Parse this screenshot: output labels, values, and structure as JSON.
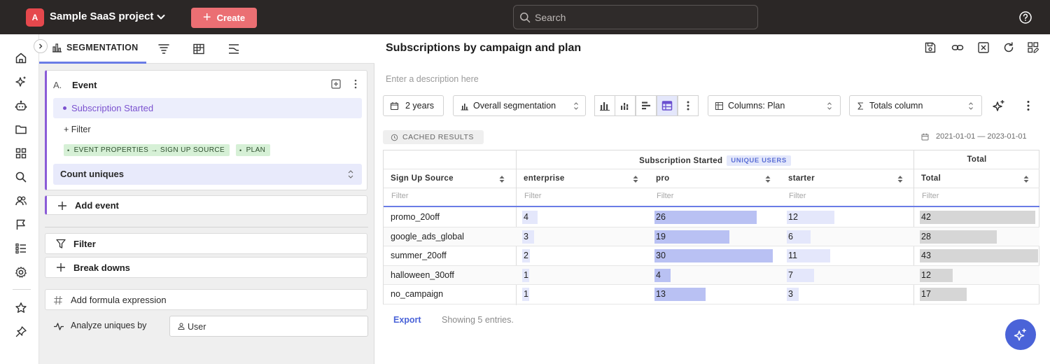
{
  "topbar": {
    "project_badge": "A",
    "project_name": "Sample SaaS project",
    "create_label": "Create",
    "search_placeholder": "Search"
  },
  "nav_rail": {
    "icons": [
      "home-icon",
      "sparkle-icon",
      "bot-icon",
      "folder-icon",
      "apps-icon",
      "search-icon",
      "users-icon",
      "flag-icon",
      "checklist-icon",
      "settings-icon",
      "star-icon",
      "pin-icon"
    ]
  },
  "query_panel": {
    "tab_segmentation": "SEGMENTATION",
    "event": {
      "letter": "A.",
      "title": "Event",
      "selected_event": "Subscription Started",
      "filter_label": "+ Filter",
      "group_pills": [
        "EVENT PROPERTIES → SIGN UP SOURCE",
        "PLAN"
      ],
      "measure": "Count uniques"
    },
    "add_event_label": "Add event",
    "filter_label": "Filter",
    "breakdowns_label": "Break downs",
    "formula_label": "Add formula expression",
    "analyze_label": "Analyze uniques by",
    "analyze_value": "User"
  },
  "report": {
    "title": "Subscriptions by campaign and plan",
    "description_placeholder": "Enter a description here",
    "date_range_label": "2 years",
    "segmentation_mode": "Overall segmentation",
    "columns_label": "Columns: Plan",
    "totals_label": "Totals column",
    "cached_label": "CACHED RESULTS",
    "date_span": "2021-01-01 — 2023-01-01",
    "export_label": "Export",
    "showing_label": "Showing 5 entries."
  },
  "table": {
    "group_header": "Subscription Started",
    "group_badge": "UNIQUE USERS",
    "total_group_header": "Total",
    "columns": [
      "Sign Up Source",
      "enterprise",
      "pro",
      "starter",
      "Total"
    ],
    "filter_placeholder": "Filter",
    "rows": [
      {
        "source": "promo_20off",
        "enterprise": "4",
        "pro": "26",
        "starter": "12",
        "total": "42"
      },
      {
        "source": "google_ads_global",
        "enterprise": "3",
        "pro": "19",
        "starter": "6",
        "total": "28"
      },
      {
        "source": "summer_20off",
        "enterprise": "2",
        "pro": "30",
        "starter": "11",
        "total": "43"
      },
      {
        "source": "halloween_30off",
        "enterprise": "1",
        "pro": "4",
        "starter": "7",
        "total": "12"
      },
      {
        "source": "no_campaign",
        "enterprise": "1",
        "pro": "13",
        "starter": "3",
        "total": "17"
      }
    ]
  },
  "colors": {
    "accent": "#4a63d8",
    "event_purple": "#7b52cf",
    "create_button": "#eb6f73",
    "bar_light": "#e4e7fb",
    "bar_strong": "#b9c1f3",
    "bar_total": "#d6d6d6"
  }
}
